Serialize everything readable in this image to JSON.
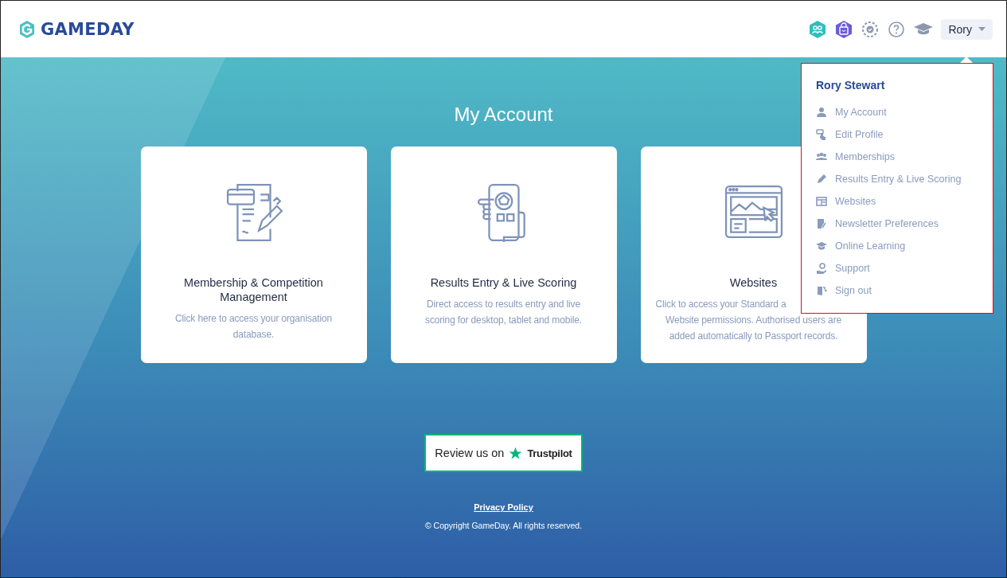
{
  "header": {
    "logo": "GAMEDAY",
    "user_button": "Rory"
  },
  "page": {
    "title": "My Account"
  },
  "cards": [
    {
      "title": "Membership & Competition Management",
      "description": [
        "Click here to access your organisation database."
      ]
    },
    {
      "title": "Results Entry & Live Scoring",
      "description": [
        "Direct access to results entry and live scoring for desktop, tablet and mobile."
      ]
    },
    {
      "title": "Websites",
      "description": [
        "Click to access your Standard a",
        "Website permissions. Authorised users are",
        "added automatically to Passport records."
      ]
    }
  ],
  "review_button": {
    "prefix": "Review us on",
    "brand": "Trustpilot"
  },
  "footer": {
    "link": "Privacy Policy",
    "copyright": "© Copyright GameDay. All rights reserved."
  },
  "user_menu": {
    "name": "Rory Stewart",
    "items": [
      {
        "label": "My Account"
      },
      {
        "label": "Edit Profile"
      },
      {
        "label": "Memberships"
      },
      {
        "label": "Results Entry & Live Scoring"
      },
      {
        "label": "Websites"
      },
      {
        "label": "Newsletter Preferences"
      },
      {
        "label": "Online Learning"
      },
      {
        "label": "Support"
      },
      {
        "label": "Sign out"
      }
    ]
  }
}
